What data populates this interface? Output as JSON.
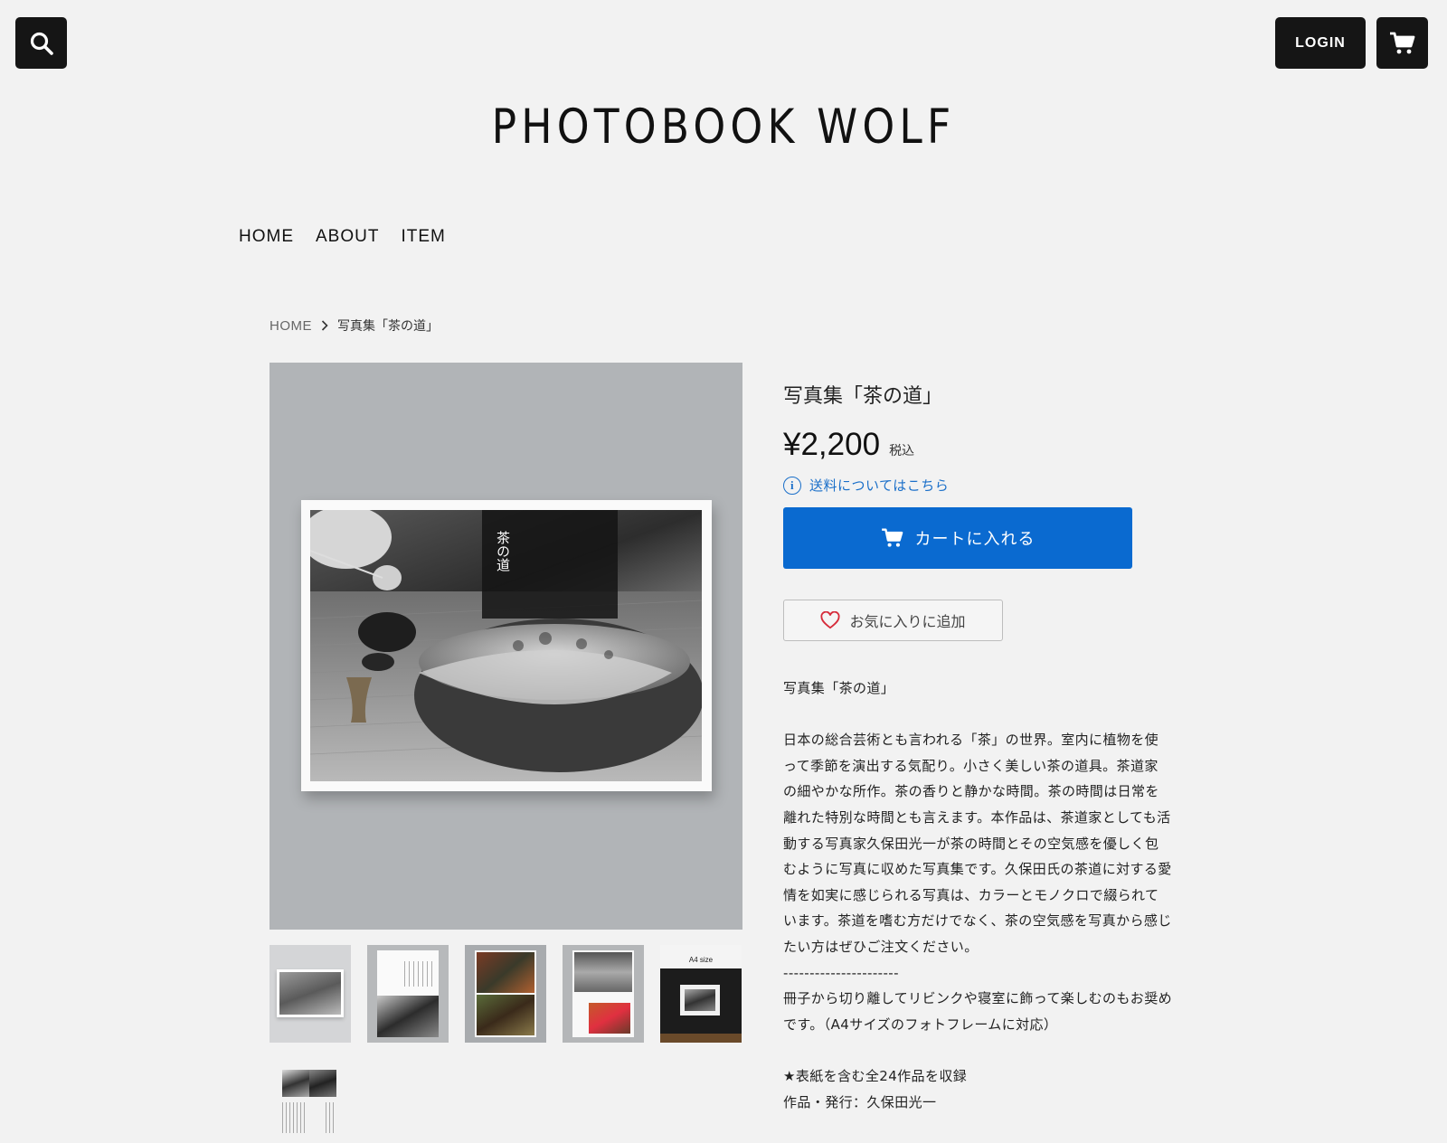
{
  "header": {
    "login_label": "LOGIN",
    "logo": "PHOTOBOOK WOLF",
    "icons": [
      "search-icon",
      "cart-icon"
    ]
  },
  "nav": {
    "items": [
      {
        "label": "HOME"
      },
      {
        "label": "ABOUT"
      },
      {
        "label": "ITEM"
      }
    ]
  },
  "breadcrumb": {
    "home": "HOME",
    "current": "写真集「茶の道」"
  },
  "gallery": {
    "cover_text": "茶の道",
    "thumb_a4_label": "A4 size"
  },
  "product": {
    "title": "写真集「茶の道」",
    "price": "¥2,200",
    "tax_label": "税込",
    "shipping_link": "送料についてはこちら",
    "add_to_cart": "カートに入れる",
    "favorite": "お気に入りに追加",
    "desc_title": "写真集「茶の道」",
    "desc_body": "日本の総合芸術とも言われる「茶」の世界。室内に植物を使って季節を演出する気配り。小さく美しい茶の道具。茶道家の細やかな所作。茶の香りと静かな時間。茶の時間は日常を離れた特別な時間とも言えます。本作品は、茶道家としても活動する写真家久保田光一が茶の時間とその空気感を優しく包むように写真に収めた写真集です。久保田氏の茶道に対する愛情を如実に感じられる写真は、カラーとモノクロで綴られています。茶道を嗜む方だけでなく、茶の空気感を写真から感じたい方はぜひご注文ください。",
    "divider": "----------------------",
    "desc_note": "冊子から切り離してリビンクや寝室に飾って楽しむのもお奨めです。（A4サイズのフォトフレームに対応）",
    "desc_count": "★表紙を含む全24作品を収録",
    "desc_author": "作品・発行：久保田光一"
  },
  "colors": {
    "accent": "#0a6ad0",
    "link": "#1a6fc9",
    "dark_button": "#151515",
    "favorite_heart": "#d62b3a"
  }
}
